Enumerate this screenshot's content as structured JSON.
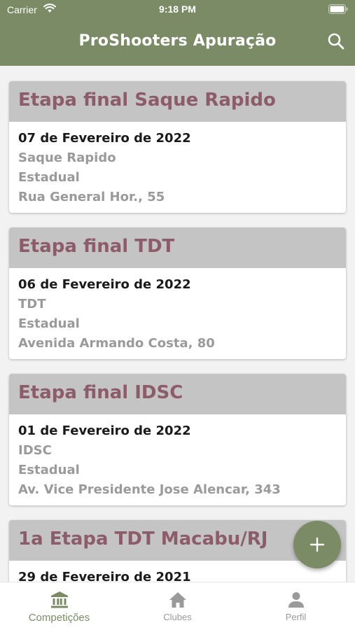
{
  "status_bar": {
    "carrier": "Carrier",
    "time": "9:18 PM"
  },
  "app_bar": {
    "title": "ProShooters Apuração",
    "search_icon": "search-icon"
  },
  "colors": {
    "accent": "#7b8b65",
    "card_title": "#8c5c6a",
    "card_header_bg": "#c4c4c4"
  },
  "competitions": [
    {
      "title": "Etapa final Saque Rapido",
      "date": "07 de Fevereiro de 2022",
      "type": "Saque Rapido",
      "level": "Estadual",
      "address": "Rua General Hor., 55"
    },
    {
      "title": "Etapa final TDT",
      "date": "06 de Fevereiro de 2022",
      "type": "TDT",
      "level": "Estadual",
      "address": "Avenida Armando Costa, 80"
    },
    {
      "title": "Etapa final IDSC",
      "date": "01 de Fevereiro de 2022",
      "type": "IDSC",
      "level": "Estadual",
      "address": "Av. Vice Presidente Jose Alencar, 343"
    },
    {
      "title": "1a Etapa TDT Macabu/RJ",
      "date": "29 de Fevereiro de 2021"
    }
  ],
  "fab": {
    "icon": "plus-icon"
  },
  "tabs": [
    {
      "label": "Competições",
      "icon": "bank-icon",
      "active": true
    },
    {
      "label": "Clubes",
      "icon": "home-icon",
      "active": false
    },
    {
      "label": "Perfil",
      "icon": "person-icon",
      "active": false
    }
  ]
}
